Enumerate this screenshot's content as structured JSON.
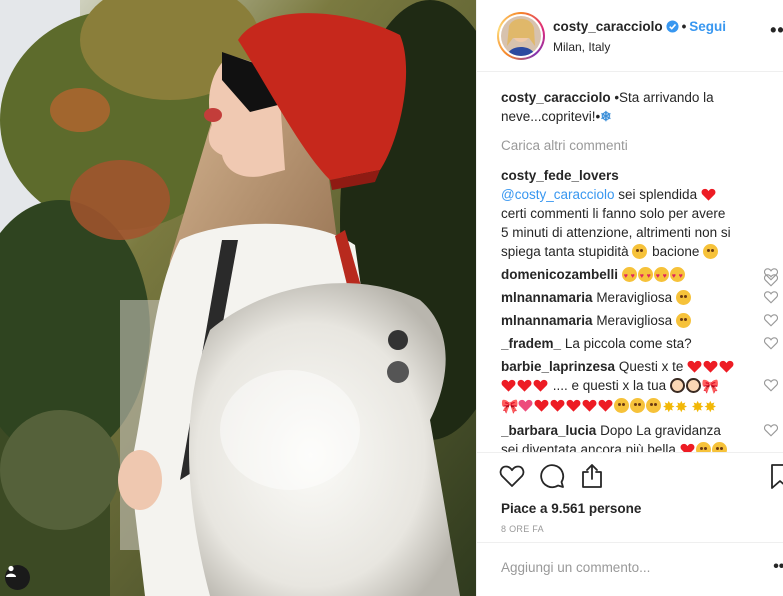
{
  "header": {
    "username": "costy_caracciolo",
    "separator": "•",
    "follow_label": "Segui",
    "location": "Milan, Italy",
    "more_icon": "•••"
  },
  "caption": {
    "username": "costy_caracciolo",
    "text": "•Sta arrivando la neve...copritevi!•"
  },
  "load_more_label": "Carica altri commenti",
  "comments": [
    {
      "username": "costy_fede_lovers",
      "mention": "@costy_caracciolo",
      "text_parts": [
        "sei splendida",
        "certi commenti li fanno solo per avere 5 minuti di attenzione, altrimenti non si spiega tanta stupidità",
        "bacione"
      ]
    },
    {
      "username": "domenicozambelli",
      "text": ""
    },
    {
      "username": "mlnannamaria",
      "text": "Meravigliosa"
    },
    {
      "username": "mlnannamaria",
      "text": "Meravigliosa"
    },
    {
      "username": "_fradem_",
      "text": "La piccola come sta?"
    },
    {
      "username": "barbie_laprinzesa",
      "text_parts": [
        "Questi x te",
        ".... e questi x la tua"
      ]
    },
    {
      "username": "_barbara_lucia",
      "text": "Dopo La gravidanza sei diventata ancora più bella"
    }
  ],
  "likes": "Piace a 9.561 persone",
  "time": "8 ORE FA",
  "add_comment": {
    "placeholder": "Aggiungi un commento..."
  },
  "icons": [
    "heart-icon",
    "comment-icon",
    "share-icon",
    "bookmark-icon",
    "user-tag-icon",
    "verified-badge-icon"
  ],
  "colors": {
    "link": "#3897f0",
    "heart": "#ed1c24",
    "text": "#262626",
    "muted": "#999999"
  }
}
